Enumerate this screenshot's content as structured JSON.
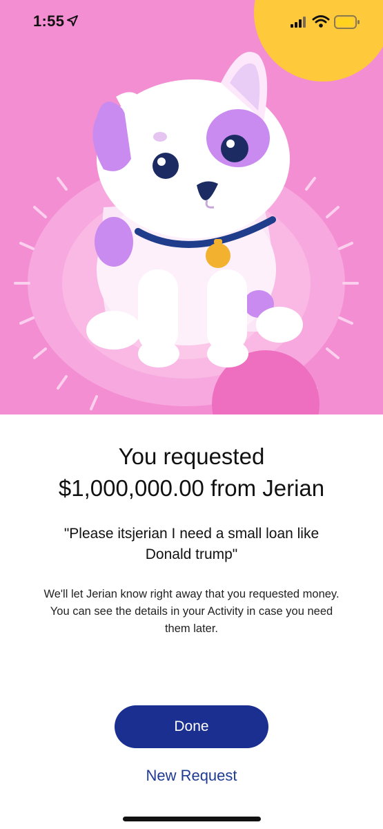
{
  "status_bar": {
    "time": "1:55",
    "icons": [
      "location-arrow-icon",
      "cellular-signal-icon",
      "wifi-icon",
      "battery-icon"
    ],
    "battery_color": "#ffd21f"
  },
  "hero": {
    "illustration": "puppy-on-rug",
    "background_color": "#f48ed2",
    "sun_color": "#ffc93c"
  },
  "confirmation": {
    "title_line1": "You requested",
    "title_line2": "$1,000,000.00 from Jerian",
    "note_line1": "\"Please itsjerian I need a small loan like",
    "note_line2": "Donald trump\"",
    "info_line1": "We'll let Jerian know right away that you requested money.",
    "info_line2": "You can see the details in your Activity in case you need",
    "info_line3": "them later."
  },
  "actions": {
    "done_label": "Done",
    "new_request_label": "New Request",
    "primary_color": "#1a2f8f",
    "link_color": "#1f3a93"
  }
}
